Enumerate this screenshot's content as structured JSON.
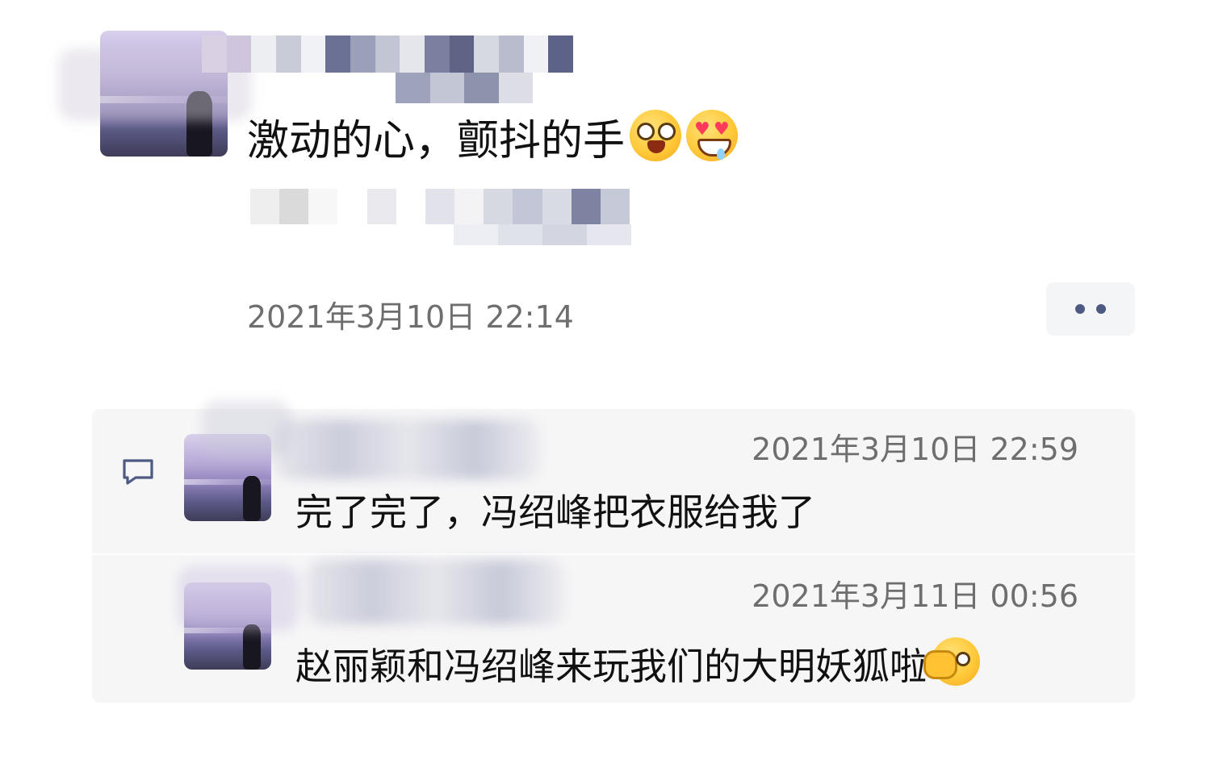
{
  "post": {
    "text": "激动的心，颤抖的手",
    "emojis": [
      "star-struck-emoji",
      "heart-eyes-drool-emoji"
    ],
    "timestamp": "2021年3月10日 22:14"
  },
  "more_button": {
    "icon": "more-dots-icon"
  },
  "comments": [
    {
      "timestamp": "2021年3月10日 22:59",
      "text": "完了完了，冯绍峰把衣服给我了",
      "emoji": ""
    },
    {
      "timestamp": "2021年3月11日 00:56",
      "text": "赵丽颖和冯绍峰来玩我们的大明妖狐啦",
      "emoji": "ok-wink-emoji"
    }
  ],
  "colors": {
    "text": "#111111",
    "timestamp": "#6e6e6e",
    "comment_bg": "#f6f6f7",
    "more_dots": "#4d5a82",
    "comment_icon": "#4d5a82"
  }
}
